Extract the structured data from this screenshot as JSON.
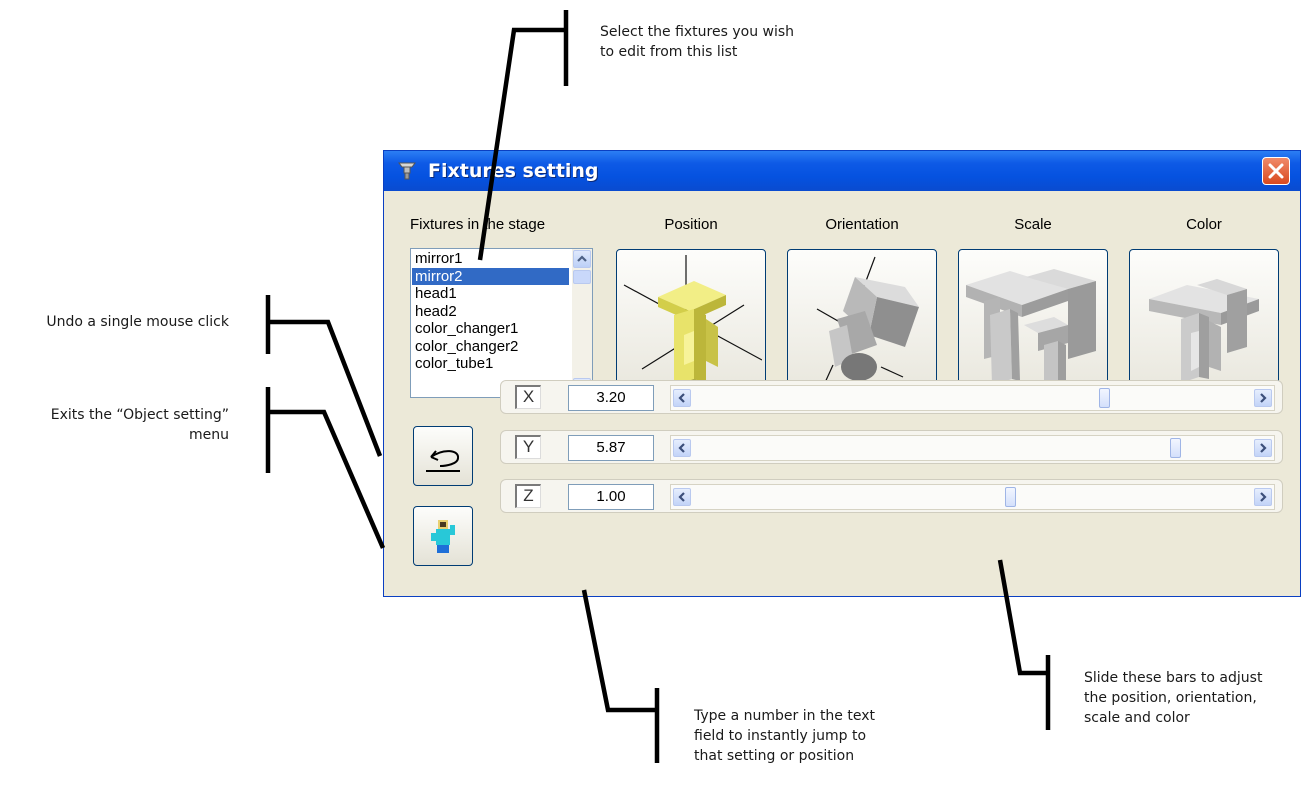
{
  "annotations": {
    "fixture_list": [
      "Select the fixtures you wish",
      "to edit from this list"
    ],
    "undo": [
      "Undo a single mouse click"
    ],
    "exit": [
      "Exits the “Object setting”",
      "menu"
    ],
    "sliders": [
      "Slide these bars to adjust",
      "the position, orientation,",
      "scale and color"
    ],
    "text_field": [
      "Type a number in the text",
      "field to instantly jump to",
      "that setting or position"
    ]
  },
  "window": {
    "title": "Fixtures setting"
  },
  "fixtures_list": {
    "label": "Fixtures in the stage",
    "items": [
      "mirror1",
      "mirror2",
      "head1",
      "head2",
      "color_changer1",
      "color_changer2",
      "color_tube1"
    ],
    "selected": "mirror2"
  },
  "tabs": [
    {
      "label": "Position",
      "active": true
    },
    {
      "label": "Orientation",
      "active": false
    },
    {
      "label": "Scale",
      "active": false
    },
    {
      "label": "Color",
      "active": false
    }
  ],
  "sliders": [
    {
      "axis": "X",
      "value": "3.20",
      "fraction": 0.74
    },
    {
      "axis": "Y",
      "value": "5.87",
      "fraction": 0.87
    },
    {
      "axis": "Z",
      "value": "1.00",
      "fraction": 0.57
    }
  ],
  "colors": {
    "title_bar": "#0a53e2",
    "selection": "#316ac5",
    "position_model": "#e6e05a",
    "model_gray": "#c0c0c0",
    "close_button": "#d9491f"
  },
  "icons": {
    "title": "fixture-lamp-icon",
    "close": "close-icon",
    "undo": "undo-icon",
    "exit": "waving-person-icon",
    "scroll_up": "chevron-up-icon",
    "scroll_down": "chevron-down-icon",
    "slider_left": "chevron-left-icon",
    "slider_right": "chevron-right-icon"
  }
}
